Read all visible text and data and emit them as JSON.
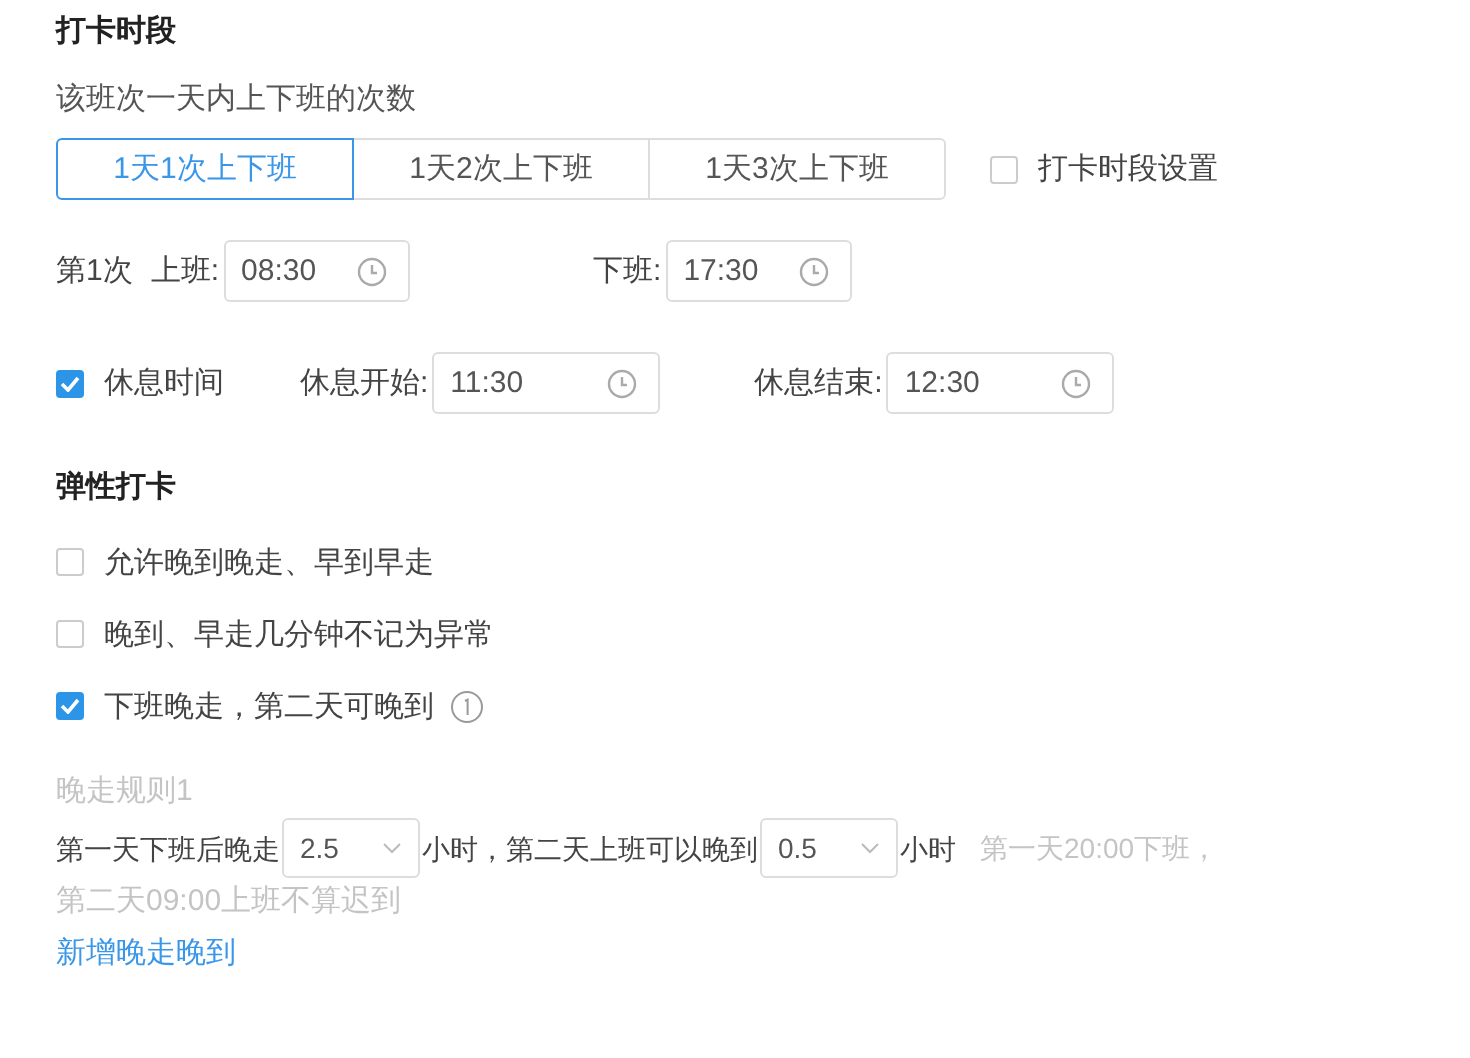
{
  "section_title": "打卡时段",
  "count_label": "该班次一天内上下班的次数",
  "count_options": [
    {
      "label": "1天1次上下班",
      "selected": true
    },
    {
      "label": "1天2次上下班",
      "selected": false
    },
    {
      "label": "1天3次上下班",
      "selected": false
    }
  ],
  "period_setting": {
    "label": "打卡时段设置",
    "checked": false
  },
  "shifts": [
    {
      "label": "第1次",
      "start_label": "上班:",
      "start": "08:30",
      "end_label": "下班:",
      "end": "17:30"
    }
  ],
  "rest": {
    "label": "休息时间",
    "checked": true,
    "start_label": "休息开始:",
    "start": "11:30",
    "end_label": "休息结束:",
    "end": "12:30"
  },
  "flex_title": "弹性打卡",
  "flex_options": [
    {
      "label": "允许晚到晚走、早到早走",
      "checked": false,
      "info": false
    },
    {
      "label": "晚到、早走几分钟不记为异常",
      "checked": false,
      "info": false
    },
    {
      "label": "下班晚走，第二天可晚到",
      "checked": true,
      "info": true
    }
  ],
  "rule": {
    "title": "晚走规则1",
    "prefix": "第一天下班后晚走",
    "late_leave": "2.5",
    "middle": "小时，第二天上班可以晚到",
    "late_arrive": "0.5",
    "suffix": "小时",
    "hint_lines": [
      "第一天20:00下班，",
      "第二天09:00上班不算迟到"
    ]
  },
  "add_link": "新增晚走晚到"
}
